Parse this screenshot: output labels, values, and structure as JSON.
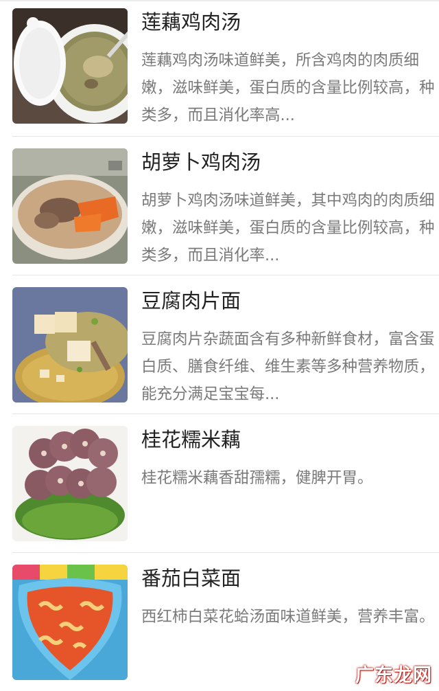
{
  "recipes": [
    {
      "title": "莲藕鸡肉汤",
      "desc": "莲藕鸡肉汤味道鲜美，所含鸡肉的肉质细嫩，滋味鲜美，蛋白质的含量比例较高，种类多，而且消化率高...",
      "image": "lotus-root-chicken-soup-photo"
    },
    {
      "title": "胡萝卜鸡肉汤",
      "desc": "胡萝卜鸡肉汤味道鲜美，其中鸡肉的肉质细嫩，滋味鲜美，蛋白质的含量比例较高，种类多，而且消化率...",
      "image": "carrot-chicken-soup-photo"
    },
    {
      "title": "豆腐肉片面",
      "desc": "豆腐肉片杂蔬面含有多种新鲜食材，富含蛋白质、膳食纤维、维生素等多种营养物质，能充分满足宝宝每...",
      "image": "tofu-pork-noodle-photo"
    },
    {
      "title": "桂花糯米藕",
      "desc": "桂花糯米藕香甜孺糯，健脾开胃。",
      "image": "osmanthus-glutinous-rice-lotus-photo"
    },
    {
      "title": "番茄白菜面",
      "desc": "西红柿白菜花蛤汤面味道鲜美，营养丰富。",
      "image": "tomato-cabbage-noodle-photo"
    }
  ],
  "watermark": "广东龙网"
}
